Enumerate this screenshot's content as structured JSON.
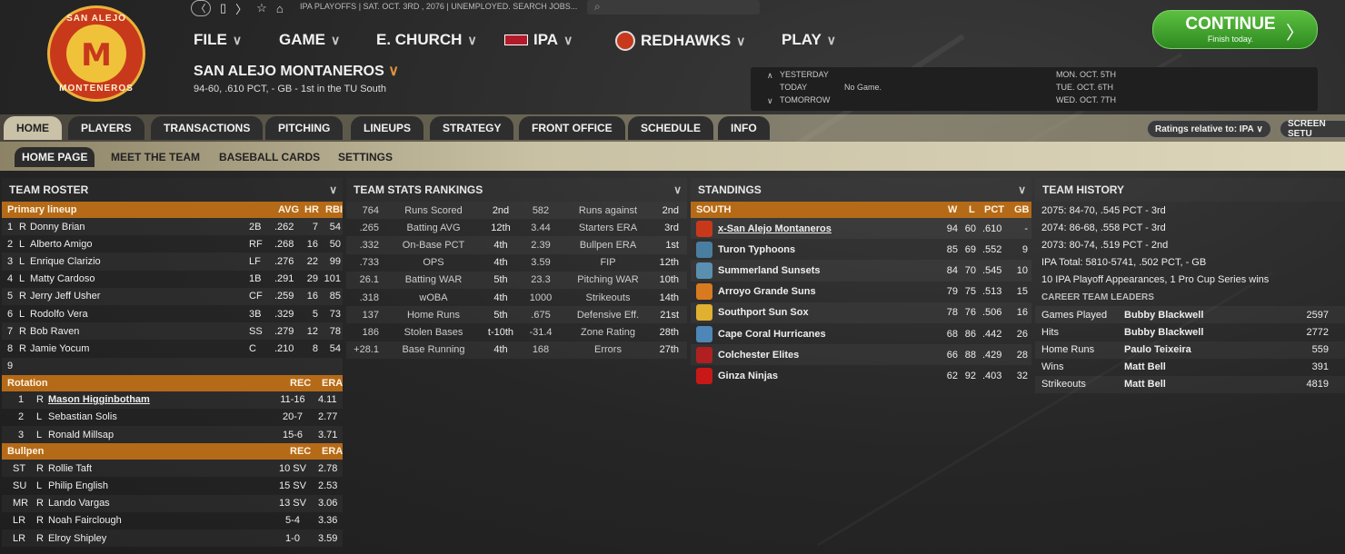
{
  "logo": {
    "text_top": "SAN ALEJO",
    "letter": "M",
    "text_bottom": "MONTENEROS"
  },
  "topbar": {
    "breadcrumb": "IPA PLAYOFFS  |  SAT. OCT. 3RD , 2076  |  UNEMPLOYED. SEARCH JOBS...",
    "search_icon": "search-icon"
  },
  "menu": [
    {
      "label": "FILE"
    },
    {
      "label": "GAME"
    },
    {
      "label": "E. CHURCH"
    },
    {
      "label": "IPA"
    },
    {
      "label": "REDHAWKS"
    },
    {
      "label": "PLAY"
    }
  ],
  "team": {
    "name": "SAN ALEJO MONTANEROS",
    "record": "94-60, .610 PCT, - GB - 1st in the TU South"
  },
  "schedule": {
    "yesterday_label": "YESTERDAY",
    "today_label": "TODAY",
    "tomorrow_label": "TOMORROW",
    "today_value": "No Game.",
    "d1": "MON. OCT. 5TH",
    "d2": "TUE. OCT. 6TH",
    "d3": "WED. OCT. 7TH"
  },
  "continue": {
    "label": "CONTINUE",
    "sub": "Finish today."
  },
  "tabs": [
    "HOME",
    "PLAYERS",
    "TRANSACTIONS",
    "PITCHING",
    "LINEUPS",
    "STRATEGY",
    "FRONT OFFICE",
    "SCHEDULE",
    "INFO"
  ],
  "ratings_btn": "Ratings relative to: IPA",
  "screen_btn": "SCREEN SETU",
  "subtabs": [
    "HOME PAGE",
    "MEET THE TEAM",
    "BASEBALL CARDS",
    "SETTINGS"
  ],
  "roster": {
    "title": "TEAM ROSTER",
    "lineup_header": {
      "label": "Primary lineup",
      "avg": "AVG",
      "hr": "HR",
      "rbi": "RBI"
    },
    "lineup": [
      {
        "n": "1",
        "h": "R",
        "name": "Donny Brian",
        "pos": "2B",
        "avg": ".262",
        "hr": "7",
        "rbi": "54"
      },
      {
        "n": "2",
        "h": "L",
        "name": "Alberto Amigo",
        "pos": "RF",
        "avg": ".268",
        "hr": "16",
        "rbi": "50"
      },
      {
        "n": "3",
        "h": "L",
        "name": "Enrique Clarizio",
        "pos": "LF",
        "avg": ".276",
        "hr": "22",
        "rbi": "99"
      },
      {
        "n": "4",
        "h": "L",
        "name": "Matty Cardoso",
        "pos": "1B",
        "avg": ".291",
        "hr": "29",
        "rbi": "101"
      },
      {
        "n": "5",
        "h": "R",
        "name": "Jerry Jeff Usher",
        "pos": "CF",
        "avg": ".259",
        "hr": "16",
        "rbi": "85"
      },
      {
        "n": "6",
        "h": "L",
        "name": "Rodolfo Vera",
        "pos": "3B",
        "avg": ".329",
        "hr": "5",
        "rbi": "73"
      },
      {
        "n": "7",
        "h": "R",
        "name": "Bob Raven",
        "pos": "SS",
        "avg": ".279",
        "hr": "12",
        "rbi": "78"
      },
      {
        "n": "8",
        "h": "R",
        "name": "Jamie Yocum",
        "pos": "C",
        "avg": ".210",
        "hr": "8",
        "rbi": "54"
      },
      {
        "n": "9",
        "h": "",
        "name": "",
        "pos": "",
        "avg": "",
        "hr": "",
        "rbi": ""
      }
    ],
    "rotation_header": {
      "label": "Rotation",
      "rec": "REC",
      "era": "ERA"
    },
    "rotation": [
      {
        "n": "1",
        "h": "R",
        "name": "Mason Higginbotham",
        "rec": "11-16",
        "era": "4.11"
      },
      {
        "n": "2",
        "h": "L",
        "name": "Sebastian Solis",
        "rec": "20-7",
        "era": "2.77"
      },
      {
        "n": "3",
        "h": "L",
        "name": "Ronald Millsap",
        "rec": "15-6",
        "era": "3.71"
      }
    ],
    "bullpen_header": {
      "label": "Bullpen",
      "rec": "REC",
      "era": "ERA"
    },
    "bullpen": [
      {
        "role": "ST",
        "h": "R",
        "name": "Rollie Taft",
        "rec": "10 SV",
        "era": "2.78"
      },
      {
        "role": "SU",
        "h": "L",
        "name": "Philip English",
        "rec": "15 SV",
        "era": "2.53"
      },
      {
        "role": "MR",
        "h": "R",
        "name": "Lando Vargas",
        "rec": "13 SV",
        "era": "3.06"
      },
      {
        "role": "LR",
        "h": "R",
        "name": "Noah Fairclough",
        "rec": "5-4",
        "era": "3.36"
      },
      {
        "role": "LR",
        "h": "R",
        "name": "Elroy Shipley",
        "rec": "1-0",
        "era": "3.59"
      }
    ]
  },
  "stats": {
    "title": "TEAM STATS RANKINGS",
    "rows": [
      {
        "v1": "764",
        "l1": "Runs Scored",
        "r1": "2nd",
        "v2": "582",
        "l2": "Runs against",
        "r2": "2nd"
      },
      {
        "v1": ".265",
        "l1": "Batting AVG",
        "r1": "12th",
        "v2": "3.44",
        "l2": "Starters ERA",
        "r2": "3rd"
      },
      {
        "v1": ".332",
        "l1": "On-Base PCT",
        "r1": "4th",
        "v2": "2.39",
        "l2": "Bullpen ERA",
        "r2": "1st"
      },
      {
        "v1": ".733",
        "l1": "OPS",
        "r1": "4th",
        "v2": "3.59",
        "l2": "FIP",
        "r2": "12th"
      },
      {
        "v1": "26.1",
        "l1": "Batting WAR",
        "r1": "5th",
        "v2": "23.3",
        "l2": "Pitching WAR",
        "r2": "10th"
      },
      {
        "v1": ".318",
        "l1": "wOBA",
        "r1": "4th",
        "v2": "1000",
        "l2": "Strikeouts",
        "r2": "14th"
      },
      {
        "v1": "137",
        "l1": "Home Runs",
        "r1": "5th",
        "v2": ".675",
        "l2": "Defensive Eff.",
        "r2": "21st"
      },
      {
        "v1": "186",
        "l1": "Stolen Bases",
        "r1": "t-10th",
        "v2": "-31.4",
        "l2": "Zone Rating",
        "r2": "28th"
      },
      {
        "v1": "+28.1",
        "l1": "Base Running",
        "r1": "4th",
        "v2": "168",
        "l2": "Errors",
        "r2": "27th"
      }
    ]
  },
  "standings": {
    "title": "STANDINGS",
    "header": {
      "label": "SOUTH",
      "w": "W",
      "l": "L",
      "pct": "PCT",
      "gb": "GB"
    },
    "teams": [
      {
        "name": "x-San Alejo Montaneros",
        "w": "94",
        "l": "60",
        "pct": ".610",
        "gb": "-",
        "color": "#c8391c"
      },
      {
        "name": "Turon Typhoons",
        "w": "85",
        "l": "69",
        "pct": ".552",
        "gb": "9",
        "color": "#4a7ea0"
      },
      {
        "name": "Summerland Sunsets",
        "w": "84",
        "l": "70",
        "pct": ".545",
        "gb": "10",
        "color": "#5a8fb0"
      },
      {
        "name": "Arroyo Grande Suns",
        "w": "79",
        "l": "75",
        "pct": ".513",
        "gb": "15",
        "color": "#d87a20"
      },
      {
        "name": "Southport Sun Sox",
        "w": "78",
        "l": "76",
        "pct": ".506",
        "gb": "16",
        "color": "#e0b030"
      },
      {
        "name": "Cape Coral Hurricanes",
        "w": "68",
        "l": "86",
        "pct": ".442",
        "gb": "26",
        "color": "#4f86b8"
      },
      {
        "name": "Colchester Elites",
        "w": "66",
        "l": "88",
        "pct": ".429",
        "gb": "28",
        "color": "#b02020"
      },
      {
        "name": "Ginza Ninjas",
        "w": "62",
        "l": "92",
        "pct": ".403",
        "gb": "32",
        "color": "#c81818"
      }
    ]
  },
  "history": {
    "title": "TEAM HISTORY",
    "lines": [
      "2075: 84-70, .545 PCT - 3rd",
      "2074: 86-68, .558 PCT - 3rd",
      "2073: 80-74, .519 PCT - 2nd",
      "IPA Total: 5810-5741, .502 PCT, - GB",
      "10 IPA Playoff Appearances, 1 Pro Cup Series wins"
    ],
    "leaders_title": "CAREER TEAM LEADERS",
    "leaders": [
      {
        "stat": "Games Played",
        "name": "Bubby Blackwell",
        "val": "2597"
      },
      {
        "stat": "Hits",
        "name": "Bubby Blackwell",
        "val": "2772"
      },
      {
        "stat": "Home Runs",
        "name": "Paulo Teixeira",
        "val": "559"
      },
      {
        "stat": "Wins",
        "name": "Matt Bell",
        "val": "391"
      },
      {
        "stat": "Strikeouts",
        "name": "Matt Bell",
        "val": "4819"
      }
    ]
  }
}
